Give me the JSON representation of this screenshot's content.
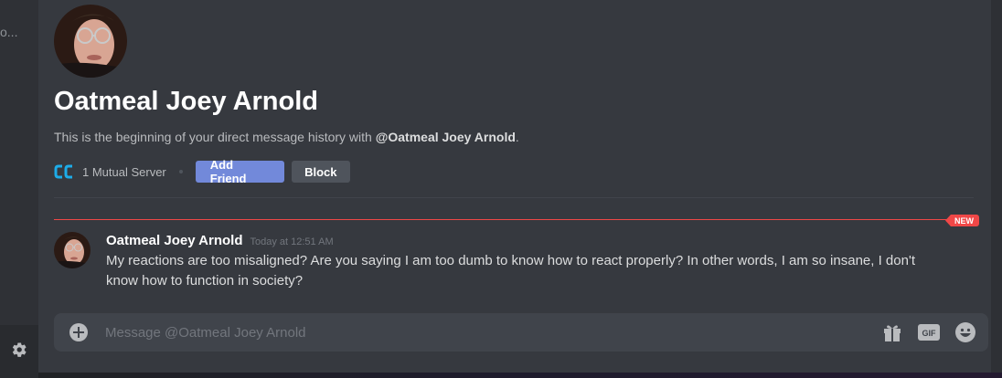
{
  "sidebar": {
    "truncated_text": "o...",
    "settings_icon": "gear-icon"
  },
  "header": {
    "title": "Oatmeal Joey Arnold",
    "description_prefix": "This is the beginning of your direct message history with ",
    "description_mention": "@Oatmeal Joey Arnold",
    "description_suffix": ".",
    "mutual_servers": "1 Mutual Server",
    "add_friend_label": "Add Friend",
    "block_label": "Block"
  },
  "divider": {
    "new_label": "NEW"
  },
  "messages": [
    {
      "author": "Oatmeal Joey Arnold",
      "timestamp": "Today at 12:51 AM",
      "text": "My reactions are too misaligned? Are you saying I am too dumb to know how to react properly? In other words, I am so insane, I don't know how to function in society?"
    }
  ],
  "composer": {
    "placeholder": "Message @Oatmeal Joey Arnold",
    "value": ""
  },
  "colors": {
    "background": "#36393f",
    "sidebar": "#2f3136",
    "accent": "#7289da",
    "danger": "#f04747",
    "composer": "#40444b"
  }
}
